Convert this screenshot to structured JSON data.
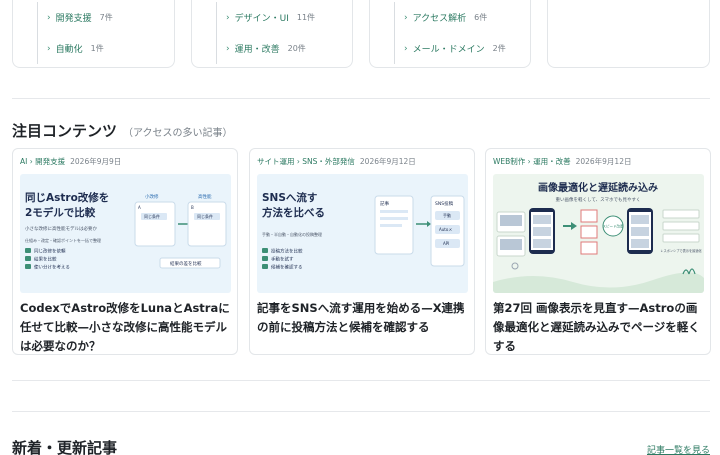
{
  "categories": {
    "col1": [
      {
        "name": "開発支援",
        "count": "7件"
      },
      {
        "name": "自動化",
        "count": "1件"
      }
    ],
    "col2": [
      {
        "name": "デザイン・UI",
        "count": "11件"
      },
      {
        "name": "運用・改善",
        "count": "20件"
      }
    ],
    "col3": [
      {
        "name": "アクセス解析",
        "count": "6件"
      },
      {
        "name": "メール・ドメイン",
        "count": "2件"
      }
    ]
  },
  "featured": {
    "title": "注目コンテンツ",
    "subtitle": "（アクセスの多い記事）",
    "cards": [
      {
        "categories": "AI › 開発支援",
        "date": "2026年9月9日",
        "thumb": {
          "heading_line1": "同じAstro改修を",
          "heading_line2": "2モデルで比較",
          "sub": "小さな改修に高性能モデルは必要か",
          "row": "仕組み・改定・確認ポイントを一括で整理",
          "bullets": [
            "同じ改修を依頼",
            "結果を比較",
            "使い分けを考える"
          ],
          "small_label": "小改修",
          "big_label": "高性能",
          "box_a": "A",
          "box_b": "B",
          "box_item": "同じ条件",
          "result": "結果の差を比較"
        },
        "title": "CodexでAstro改修をLunaとAstraに任せて比較—小さな改修に高性能モデルは必要なのか？"
      },
      {
        "categories": "サイト運用 › SNS・外部発信",
        "date": "2026年9月12日",
        "thumb": {
          "heading_line1": "SNSへ流す",
          "heading_line2": "方法を比べる",
          "row": "手動・半自動・自動化の投稿整理",
          "bullets": [
            "投稿方法を比較",
            "手動を試す",
            "候補を確認する"
          ],
          "box_left": "記事",
          "box_right": "SNS投稿",
          "chips": [
            "手動",
            "Autoメ",
            "API"
          ]
        },
        "title": "記事をSNSへ流す運用を始める—X連携の前に投稿方法と候補を確認する"
      },
      {
        "categories": "WEB制作 › 運用・改善",
        "date": "2026年9月12日",
        "thumb": {
          "heading": "画像最適化と遅延読み込み",
          "sub": "重い画像を軽くして、スマホでも見やすく",
          "badge": "スピード改善",
          "small_note": "レスポンシブで表示を最適化"
        },
        "title": "第27回 画像表示を見直す—Astroの画像最適化と遅延読み込みでページを軽くする"
      }
    ]
  },
  "latest": {
    "title": "新着・更新記事",
    "all_link": "記事一覧を見る"
  },
  "colors": {
    "accent": "#2c7a62",
    "thumb_bg": "#eaf4fb",
    "thumb_bg_green": "#edf5ee",
    "navy": "#1d2c4f"
  }
}
